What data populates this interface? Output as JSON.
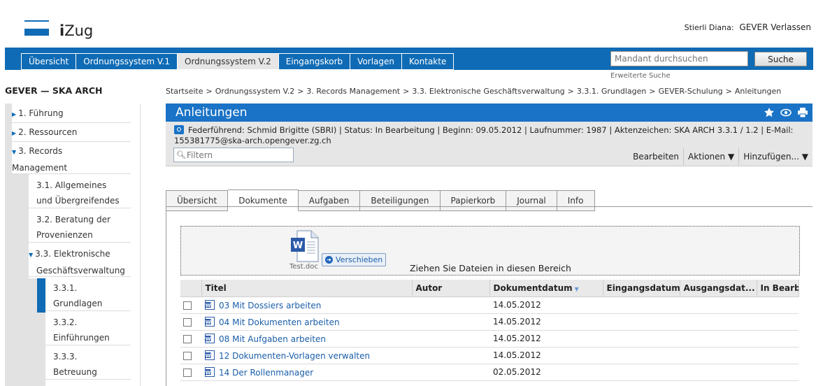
{
  "header": {
    "logo_prefix": "i",
    "logo_suffix": "Zug",
    "user_name": "Stierli Diana:",
    "logout_label": "GEVER Verlassen"
  },
  "nav": {
    "tabs": [
      "Übersicht",
      "Ordnungssystem V.1",
      "Ordnungssystem V.2",
      "Eingangskorb",
      "Vorlagen",
      "Kontakte"
    ],
    "active_tab": "Ordnungssystem V.2",
    "search_placeholder": "Mandant durchsuchen",
    "search_button": "Suche",
    "advanced_search": "Erweiterte Suche"
  },
  "sidebar": {
    "title": "GEVER — SKA ARCH",
    "items": [
      {
        "label": "1. Führung"
      },
      {
        "label": "2. Ressourcen"
      },
      {
        "label_line1": "3. Records",
        "label_line2": "Management"
      },
      {
        "label_line1": "3.1. Allgemeines",
        "label_line2": "und Übergreifendes"
      },
      {
        "label_line1": "3.2. Beratung der",
        "label_line2": "Provenienzen"
      },
      {
        "label_line1": "3.3. Elektronische",
        "label_line2": "Geschäftsverwaltung"
      },
      {
        "label_line1": "3.3.1.",
        "label_line2": "Grundlagen"
      },
      {
        "label_line1": "3.3.2.",
        "label_line2": "Einführungen"
      },
      {
        "label_line1": "3.3.3.",
        "label_line2": "Betreuung"
      }
    ]
  },
  "breadcrumb": [
    "Startseite",
    "Ordnungssystem V.2",
    "3. Records Management",
    "3.3. Elektronische Geschäftsverwaltung",
    "3.3.1. Grundlagen",
    "GEVER-Schulung",
    "Anleitungen"
  ],
  "dossier": {
    "title": "Anleitungen",
    "meta_line1": "Federführend: Schmid Brigitte (SBRI) | Status: In Bearbeitung | Beginn: 09.05.2012 | Laufnummer: 1987 | Aktenzeichen: SKA ARCH 3.3.1 / 1.2 | E-Mail:",
    "meta_line2": "155381775@ska-arch.opengever.zg.ch",
    "filter_placeholder": "Filtern",
    "actions": [
      "Bearbeiten",
      "Aktionen ▼",
      "Hinzufügen... ▼"
    ]
  },
  "tabs": [
    "Übersicht",
    "Dokumente",
    "Aufgaben",
    "Beteiligungen",
    "Papierkorb",
    "Journal",
    "Info"
  ],
  "active_tab": "Dokumente",
  "dropzone": {
    "file_caption": "Test.doc",
    "move_button": "Verschieben",
    "hint": "Ziehen Sie Dateien in diesen Bereich"
  },
  "table": {
    "columns": [
      "Titel",
      "Autor",
      "Dokumentdatum",
      "Eingangsdatum",
      "Ausgangsdat...",
      "In Bearb"
    ],
    "rows": [
      {
        "title": "03 Mit Dossiers arbeiten",
        "author": "",
        "date": "14.05.2012",
        "in": "",
        "out": "",
        "edit": ""
      },
      {
        "title": "04 Mit Dokumenten arbeiten",
        "author": "",
        "date": "14.05.2012",
        "in": "",
        "out": "",
        "edit": ""
      },
      {
        "title": "08 Mit Aufgaben arbeiten",
        "author": "",
        "date": "14.05.2012",
        "in": "",
        "out": "",
        "edit": ""
      },
      {
        "title": "12 Dokumenten-Vorlagen verwalten",
        "author": "",
        "date": "14.05.2012",
        "in": "",
        "out": "",
        "edit": ""
      },
      {
        "title": "14 Der Rollenmanager",
        "author": "",
        "date": "02.05.2012",
        "in": "",
        "out": "",
        "edit": ""
      }
    ]
  },
  "colors": {
    "brand_blue": "#0f6bb5",
    "header_blue": "#1a73c6",
    "link_blue": "#1a5ea8"
  }
}
